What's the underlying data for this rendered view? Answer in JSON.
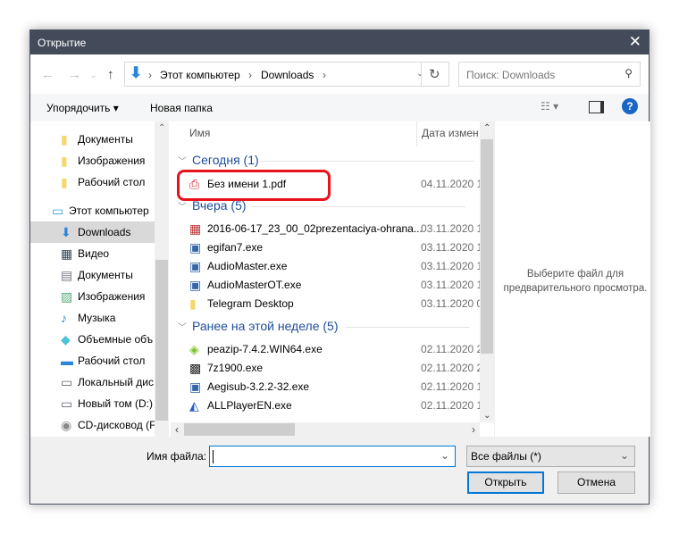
{
  "window": {
    "title": "Открытие",
    "close": "✕"
  },
  "address": {
    "path": [
      "Этот компьютер",
      "Downloads"
    ],
    "separator": "›",
    "search_placeholder": "Поиск: Downloads"
  },
  "toolbar": {
    "organize": "Упорядочить ▾",
    "new_folder": "Новая папка",
    "help": "?"
  },
  "nav_items": [
    {
      "label": "Документы",
      "icon": "folder-icon"
    },
    {
      "label": "Изображения",
      "icon": "folder-icon"
    },
    {
      "label": "Рабочий стол",
      "icon": "folder-icon"
    },
    {
      "label": "Этот компьютер",
      "icon": "computer-icon"
    },
    {
      "label": "Downloads",
      "icon": "download-icon",
      "selected": true
    },
    {
      "label": "Видео",
      "icon": "video-icon"
    },
    {
      "label": "Документы",
      "icon": "document-icon"
    },
    {
      "label": "Изображения",
      "icon": "pictures-icon"
    },
    {
      "label": "Музыка",
      "icon": "music-icon"
    },
    {
      "label": "Объемные объ",
      "icon": "3d-objects-icon"
    },
    {
      "label": "Рабочий стол",
      "icon": "desktop-icon"
    },
    {
      "label": "Локальный дис",
      "icon": "drive-icon"
    },
    {
      "label": "Новый том (D:)",
      "icon": "drive-icon"
    },
    {
      "label": "CD-дисковод (F:",
      "icon": "cd-drive-icon"
    }
  ],
  "columns": {
    "name": "Имя",
    "date": "Дата измен"
  },
  "groups": [
    {
      "label": "Сегодня (1)",
      "files": [
        {
          "name": "Без имени 1.pdf",
          "date": "04.11.2020 1",
          "icon": "pdf-icon"
        }
      ]
    },
    {
      "label": "Вчера (5)",
      "files": [
        {
          "name": "2016-06-17_23_00_02prezentaciya-ohrana...",
          "date": "03.11.2020 1",
          "icon": "archive-icon"
        },
        {
          "name": "egifan7.exe",
          "date": "03.11.2020 1",
          "icon": "installer-icon"
        },
        {
          "name": "AudioMaster.exe",
          "date": "03.11.2020 1",
          "icon": "installer-icon"
        },
        {
          "name": "AudioMasterOT.exe",
          "date": "03.11.2020 1",
          "icon": "installer-icon"
        },
        {
          "name": "Telegram Desktop",
          "date": "03.11.2020 0",
          "icon": "folder-icon"
        }
      ]
    },
    {
      "label": "Ранее на этой неделе (5)",
      "files": [
        {
          "name": "peazip-7.4.2.WIN64.exe",
          "date": "02.11.2020 2",
          "icon": "peazip-icon"
        },
        {
          "name": "7z1900.exe",
          "date": "02.11.2020 2",
          "icon": "7zip-icon"
        },
        {
          "name": "Aegisub-3.2.2-32.exe",
          "date": "02.11.2020 1",
          "icon": "installer-icon"
        },
        {
          "name": "ALLPlayerEN.exe",
          "date": "02.11.2020 1",
          "icon": "allplayer-icon"
        }
      ]
    }
  ],
  "preview": {
    "text": "Выберите файл для предварительного просмотра."
  },
  "bottom": {
    "filename_label": "Имя файла:",
    "filename_value": "",
    "filter": "Все файлы (*)",
    "open": "Открыть",
    "cancel": "Отмена"
  },
  "colors": {
    "titlebar": "#434b5b",
    "accent": "#0078d7",
    "group": "#1e4e9a",
    "highlight": "#e8121d"
  }
}
